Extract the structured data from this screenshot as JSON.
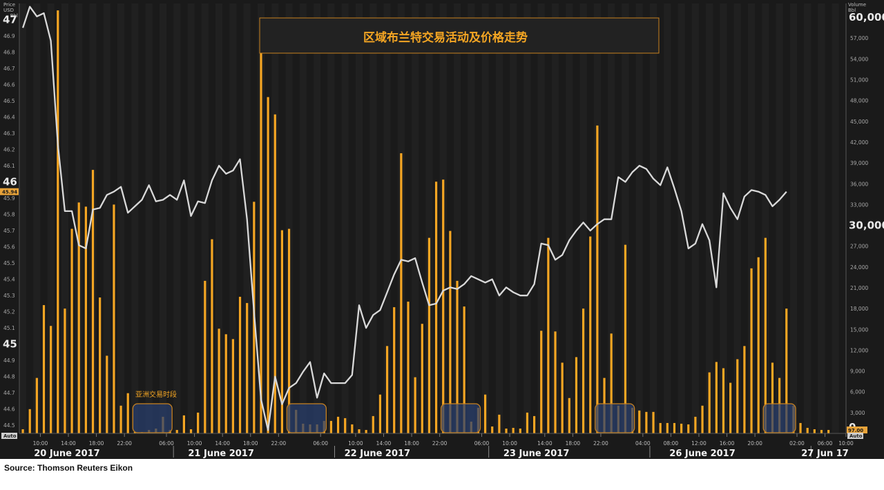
{
  "source": "Source: Thomson Reuters Eikon",
  "chart_data": {
    "type": "bar+line",
    "title": "区域布兰特交易活动及价格走势",
    "left_axis": {
      "title": [
        "Price",
        "USD",
        "Bbl"
      ],
      "min": 44.45,
      "max": 47.1,
      "ticks_small": [
        44.5,
        44.6,
        44.7,
        44.8,
        44.9,
        45.1,
        45.2,
        45.3,
        45.4,
        45.5,
        45.6,
        45.7,
        45.8,
        45.9,
        46.1,
        46.2,
        46.3,
        46.4,
        46.5,
        46.6,
        46.7,
        46.8,
        46.9
      ],
      "ticks_small_labels": [
        "44.5",
        "44.6",
        "44.7",
        "44.8",
        "44.9",
        "45.1",
        "45.2",
        "45.3",
        "45.4",
        "45.5",
        "45.6",
        "45.7",
        "45.8",
        "45.9",
        "46.1",
        "46.2",
        "46.3",
        "46.4",
        "46.5",
        "46.6",
        "46.7",
        "46.8",
        "46.9"
      ],
      "ticks_big": [
        45,
        46,
        47
      ],
      "ticks_big_labels": [
        "45",
        "46",
        "47"
      ],
      "last_value": 45.94,
      "last_value_label": "45.94",
      "auto_label": "Auto"
    },
    "right_axis": {
      "title": [
        "Volume",
        "Bbl"
      ],
      "min": 0,
      "max": 62000,
      "ticks_small": [
        3000,
        6000,
        9000,
        12000,
        15000,
        18000,
        21000,
        24000,
        27000,
        33000,
        36000,
        39000,
        42000,
        45000,
        48000,
        51000,
        54000,
        57000
      ],
      "ticks_small_labels": [
        "3,000",
        "6,000",
        "9,000",
        "12,000",
        "15,000",
        "18,000",
        "21,000",
        "24,000",
        "27,000",
        "33,000",
        "36,000",
        "39,000",
        "42,000",
        "45,000",
        "48,000",
        "51,000",
        "54,000",
        "57,000"
      ],
      "ticks_big": [
        0,
        30000,
        60000
      ],
      "ticks_big_labels": [
        "0",
        "30,000",
        "60,000"
      ],
      "last_value": 97,
      "last_value_label": "97.00",
      "auto_label": "Auto"
    },
    "x_axis": {
      "slots": 118,
      "day_boundaries": [
        22,
        45,
        67,
        90,
        113
      ],
      "time_ticks": [
        {
          "x": 2.5,
          "label": "10:00"
        },
        {
          "x": 6.5,
          "label": "14:00"
        },
        {
          "x": 10.5,
          "label": "18:00"
        },
        {
          "x": 14.5,
          "label": "22:00"
        },
        {
          "x": 20.5,
          "label": "06:00"
        },
        {
          "x": 24.5,
          "label": "10:00"
        },
        {
          "x": 28.5,
          "label": "14:00"
        },
        {
          "x": 32.5,
          "label": "18:00"
        },
        {
          "x": 36.5,
          "label": "22:00"
        },
        {
          "x": 42.5,
          "label": "06:00"
        },
        {
          "x": 47.5,
          "label": "10:00"
        },
        {
          "x": 51.5,
          "label": "14:00"
        },
        {
          "x": 55.5,
          "label": "18:00"
        },
        {
          "x": 59.5,
          "label": "22:00"
        },
        {
          "x": 65.5,
          "label": "06:00"
        },
        {
          "x": 69.5,
          "label": "10:00"
        },
        {
          "x": 74.5,
          "label": "14:00"
        },
        {
          "x": 78.5,
          "label": "18:00"
        },
        {
          "x": 82.5,
          "label": "22:00"
        },
        {
          "x": 88.5,
          "label": "04:00"
        },
        {
          "x": 92.5,
          "label": "08:00"
        },
        {
          "x": 96.5,
          "label": "12:00"
        },
        {
          "x": 100.5,
          "label": "16:00"
        },
        {
          "x": 104.5,
          "label": "20:00"
        },
        {
          "x": 110.5,
          "label": "02:00"
        },
        {
          "x": 114.5,
          "label": "06:00"
        },
        {
          "x": 117.5,
          "label": "10:00"
        }
      ],
      "day_labels": [
        {
          "x": 6.3,
          "label": "20 June 2017"
        },
        {
          "x": 28.3,
          "label": "21 June 2017"
        },
        {
          "x": 50.6,
          "label": "22 June 2017"
        },
        {
          "x": 73.3,
          "label": "23 June 2017"
        },
        {
          "x": 97,
          "label": "26 June 2017"
        },
        {
          "x": 114.5,
          "label": "27 Jun 17"
        }
      ]
    },
    "series": [
      {
        "name": "Volume",
        "kind": "bar",
        "color": "#f5a623",
        "values": [
          600,
          3500,
          8000,
          18500,
          15500,
          61000,
          18000,
          29500,
          33300,
          32700,
          38000,
          19600,
          11200,
          33000,
          4000,
          5800,
          200,
          200,
          500,
          700,
          2400,
          500,
          500,
          2600,
          600,
          3000,
          22000,
          28000,
          15100,
          14300,
          13600,
          19700,
          18800,
          33400,
          57000,
          48500,
          46000,
          29300,
          29500,
          3400,
          1400,
          1300,
          1300,
          1800,
          1800,
          2400,
          2200,
          1300,
          600,
          500,
          2500,
          5600,
          12600,
          18200,
          40400,
          19000,
          8100,
          15800,
          28200,
          36300,
          36600,
          29200,
          22000,
          18300,
          1700,
          3700,
          5600,
          1000,
          2700,
          700,
          800,
          700,
          3000,
          2500,
          14800,
          28200,
          14700,
          10200,
          5100,
          11000,
          18000,
          28400,
          44400,
          8000,
          14400,
          4000,
          27200,
          3700,
          3300,
          3100,
          3100,
          1500,
          1500,
          1500,
          1400,
          1300,
          2400,
          4000,
          8800,
          10300,
          9400,
          7300,
          10700,
          12600,
          23800,
          25400,
          28200,
          10200,
          8000,
          18000,
          4000,
          1500,
          800,
          600,
          500,
          500,
          0,
          0
        ],
        "highlight_ranges": [
          [
            16,
            22
          ],
          [
            38,
            44
          ],
          [
            60,
            66
          ],
          [
            82,
            88
          ],
          [
            106,
            111
          ]
        ]
      },
      {
        "name": "Price",
        "kind": "line",
        "color": "#d9d9d9",
        "points": [
          [
            0,
            46.95
          ],
          [
            1,
            47.08
          ],
          [
            2,
            47.02
          ],
          [
            3,
            47.04
          ],
          [
            4,
            46.87
          ],
          [
            5,
            46.23
          ],
          [
            6,
            45.82
          ],
          [
            7,
            45.82
          ],
          [
            8,
            45.61
          ],
          [
            9,
            45.59
          ],
          [
            10,
            45.83
          ],
          [
            11,
            45.84
          ],
          [
            12,
            45.92
          ],
          [
            13,
            45.94
          ],
          [
            14,
            45.97
          ],
          [
            15,
            45.81
          ],
          [
            16,
            45.85
          ],
          [
            17,
            45.89
          ],
          [
            18,
            45.98
          ],
          [
            19,
            45.88
          ],
          [
            20,
            45.89
          ],
          [
            21,
            45.92
          ],
          [
            22,
            45.89
          ],
          [
            23,
            46.01
          ],
          [
            24,
            45.79
          ],
          [
            25,
            45.88
          ],
          [
            26,
            45.87
          ],
          [
            27,
            46.01
          ],
          [
            28,
            46.1
          ],
          [
            29,
            46.05
          ],
          [
            30,
            46.07
          ],
          [
            31,
            46.14
          ],
          [
            32,
            45.77
          ],
          [
            33,
            45.2
          ],
          [
            34,
            44.66
          ],
          [
            35,
            44.47
          ],
          [
            36,
            44.8
          ],
          [
            37,
            44.63
          ],
          [
            38,
            44.73
          ],
          [
            39,
            44.76
          ],
          [
            40,
            44.83
          ],
          [
            41,
            44.89
          ],
          [
            42,
            44.67
          ],
          [
            43,
            44.82
          ],
          [
            44,
            44.76
          ],
          [
            45,
            44.76
          ],
          [
            46,
            44.76
          ],
          [
            47,
            44.81
          ],
          [
            48,
            45.24
          ],
          [
            49,
            45.1
          ],
          [
            50,
            45.18
          ],
          [
            51,
            45.21
          ],
          [
            52,
            45.32
          ],
          [
            53,
            45.43
          ],
          [
            54,
            45.52
          ],
          [
            55,
            45.51
          ],
          [
            56,
            45.53
          ],
          [
            57,
            45.38
          ],
          [
            58,
            45.24
          ],
          [
            59,
            45.25
          ],
          [
            60,
            45.33
          ],
          [
            61,
            45.35
          ],
          [
            62,
            45.34
          ],
          [
            63,
            45.37
          ],
          [
            64,
            45.42
          ],
          [
            65,
            45.4
          ],
          [
            66,
            45.38
          ],
          [
            67,
            45.4
          ],
          [
            68,
            45.3
          ],
          [
            69,
            45.35
          ],
          [
            70,
            45.32
          ],
          [
            71,
            45.3
          ],
          [
            72,
            45.3
          ],
          [
            73,
            45.37
          ],
          [
            74,
            45.62
          ],
          [
            75,
            45.61
          ],
          [
            76,
            45.52
          ],
          [
            77,
            45.55
          ],
          [
            78,
            45.64
          ],
          [
            79,
            45.7
          ],
          [
            80,
            45.75
          ],
          [
            81,
            45.7
          ],
          [
            82,
            45.74
          ],
          [
            83,
            45.77
          ],
          [
            84,
            45.77
          ],
          [
            85,
            46.03
          ],
          [
            86,
            46.0
          ],
          [
            87,
            46.06
          ],
          [
            88,
            46.1
          ],
          [
            89,
            46.08
          ],
          [
            90,
            46.02
          ],
          [
            91,
            45.98
          ],
          [
            92,
            46.09
          ],
          [
            93,
            45.96
          ],
          [
            94,
            45.82
          ],
          [
            95,
            45.59
          ],
          [
            96,
            45.62
          ],
          [
            97,
            45.74
          ],
          [
            98,
            45.64
          ],
          [
            99,
            45.35
          ],
          [
            100,
            45.93
          ],
          [
            101,
            45.84
          ],
          [
            102,
            45.77
          ],
          [
            103,
            45.91
          ],
          [
            104,
            45.95
          ],
          [
            105,
            45.94
          ],
          [
            106,
            45.92
          ],
          [
            107,
            45.85
          ],
          [
            108,
            45.89
          ],
          [
            109,
            45.94
          ]
        ]
      }
    ],
    "annotations": {
      "asia_session_label": "亚洲交易时段"
    },
    "grid": false,
    "legend": "none"
  }
}
